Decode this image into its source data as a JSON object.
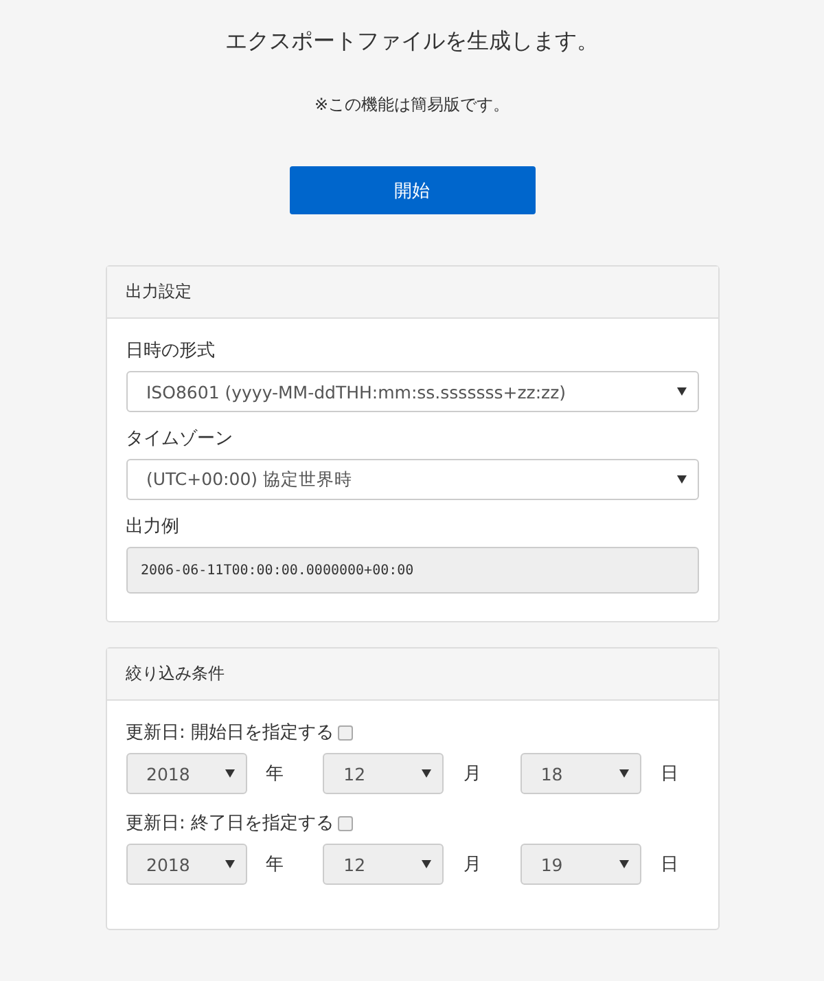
{
  "title": "エクスポートファイルを生成します。",
  "note": "※この機能は簡易版です。",
  "start_button": "開始",
  "output_settings": {
    "header": "出力設定",
    "fields": [
      {
        "kind": "select",
        "label": "日時の形式",
        "value": "ISO8601 (yyyy-MM-ddTHH:mm:ss.sssssss+zz:zz)"
      },
      {
        "kind": "select",
        "label": "タイムゾーン",
        "value": "(UTC+00:00) 協定世界時"
      },
      {
        "kind": "readonly",
        "label": "出力例",
        "value": "2006-06-11T00:00:00.0000000+00:00"
      }
    ]
  },
  "filter": {
    "header": "絞り込み条件",
    "dates": [
      {
        "label": "更新日: 開始日を指定する",
        "checked": false,
        "year": "2018",
        "year_unit": "年",
        "month": "12",
        "month_unit": "月",
        "day": "18",
        "day_unit": "日"
      },
      {
        "label": "更新日: 終了日を指定する",
        "checked": false,
        "year": "2018",
        "year_unit": "年",
        "month": "12",
        "month_unit": "月",
        "day": "19",
        "day_unit": "日"
      }
    ]
  }
}
